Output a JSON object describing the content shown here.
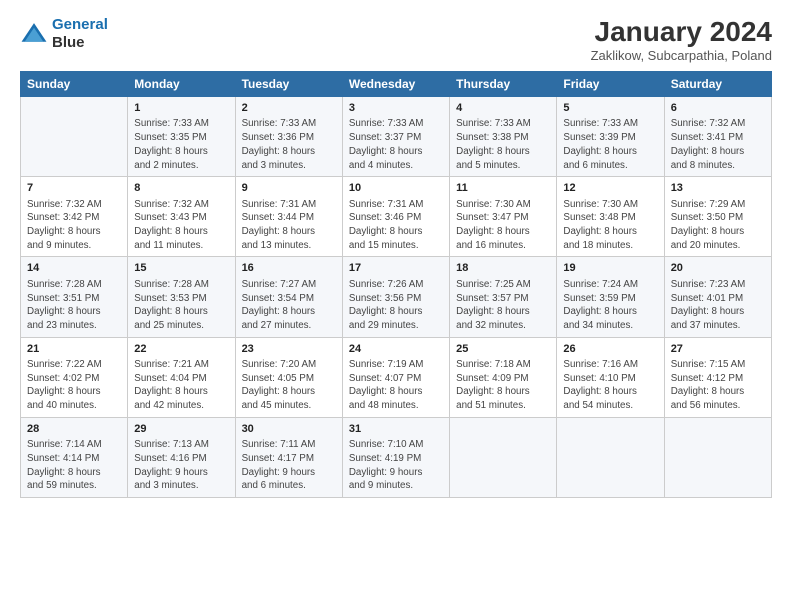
{
  "header": {
    "logo_line1": "General",
    "logo_line2": "Blue",
    "title": "January 2024",
    "subtitle": "Zaklikow, Subcarpathia, Poland"
  },
  "columns": [
    "Sunday",
    "Monday",
    "Tuesday",
    "Wednesday",
    "Thursday",
    "Friday",
    "Saturday"
  ],
  "weeks": [
    [
      {
        "num": "",
        "info": ""
      },
      {
        "num": "1",
        "info": "Sunrise: 7:33 AM\nSunset: 3:35 PM\nDaylight: 8 hours\nand 2 minutes."
      },
      {
        "num": "2",
        "info": "Sunrise: 7:33 AM\nSunset: 3:36 PM\nDaylight: 8 hours\nand 3 minutes."
      },
      {
        "num": "3",
        "info": "Sunrise: 7:33 AM\nSunset: 3:37 PM\nDaylight: 8 hours\nand 4 minutes."
      },
      {
        "num": "4",
        "info": "Sunrise: 7:33 AM\nSunset: 3:38 PM\nDaylight: 8 hours\nand 5 minutes."
      },
      {
        "num": "5",
        "info": "Sunrise: 7:33 AM\nSunset: 3:39 PM\nDaylight: 8 hours\nand 6 minutes."
      },
      {
        "num": "6",
        "info": "Sunrise: 7:32 AM\nSunset: 3:41 PM\nDaylight: 8 hours\nand 8 minutes."
      }
    ],
    [
      {
        "num": "7",
        "info": "Sunrise: 7:32 AM\nSunset: 3:42 PM\nDaylight: 8 hours\nand 9 minutes."
      },
      {
        "num": "8",
        "info": "Sunrise: 7:32 AM\nSunset: 3:43 PM\nDaylight: 8 hours\nand 11 minutes."
      },
      {
        "num": "9",
        "info": "Sunrise: 7:31 AM\nSunset: 3:44 PM\nDaylight: 8 hours\nand 13 minutes."
      },
      {
        "num": "10",
        "info": "Sunrise: 7:31 AM\nSunset: 3:46 PM\nDaylight: 8 hours\nand 15 minutes."
      },
      {
        "num": "11",
        "info": "Sunrise: 7:30 AM\nSunset: 3:47 PM\nDaylight: 8 hours\nand 16 minutes."
      },
      {
        "num": "12",
        "info": "Sunrise: 7:30 AM\nSunset: 3:48 PM\nDaylight: 8 hours\nand 18 minutes."
      },
      {
        "num": "13",
        "info": "Sunrise: 7:29 AM\nSunset: 3:50 PM\nDaylight: 8 hours\nand 20 minutes."
      }
    ],
    [
      {
        "num": "14",
        "info": "Sunrise: 7:28 AM\nSunset: 3:51 PM\nDaylight: 8 hours\nand 23 minutes."
      },
      {
        "num": "15",
        "info": "Sunrise: 7:28 AM\nSunset: 3:53 PM\nDaylight: 8 hours\nand 25 minutes."
      },
      {
        "num": "16",
        "info": "Sunrise: 7:27 AM\nSunset: 3:54 PM\nDaylight: 8 hours\nand 27 minutes."
      },
      {
        "num": "17",
        "info": "Sunrise: 7:26 AM\nSunset: 3:56 PM\nDaylight: 8 hours\nand 29 minutes."
      },
      {
        "num": "18",
        "info": "Sunrise: 7:25 AM\nSunset: 3:57 PM\nDaylight: 8 hours\nand 32 minutes."
      },
      {
        "num": "19",
        "info": "Sunrise: 7:24 AM\nSunset: 3:59 PM\nDaylight: 8 hours\nand 34 minutes."
      },
      {
        "num": "20",
        "info": "Sunrise: 7:23 AM\nSunset: 4:01 PM\nDaylight: 8 hours\nand 37 minutes."
      }
    ],
    [
      {
        "num": "21",
        "info": "Sunrise: 7:22 AM\nSunset: 4:02 PM\nDaylight: 8 hours\nand 40 minutes."
      },
      {
        "num": "22",
        "info": "Sunrise: 7:21 AM\nSunset: 4:04 PM\nDaylight: 8 hours\nand 42 minutes."
      },
      {
        "num": "23",
        "info": "Sunrise: 7:20 AM\nSunset: 4:05 PM\nDaylight: 8 hours\nand 45 minutes."
      },
      {
        "num": "24",
        "info": "Sunrise: 7:19 AM\nSunset: 4:07 PM\nDaylight: 8 hours\nand 48 minutes."
      },
      {
        "num": "25",
        "info": "Sunrise: 7:18 AM\nSunset: 4:09 PM\nDaylight: 8 hours\nand 51 minutes."
      },
      {
        "num": "26",
        "info": "Sunrise: 7:16 AM\nSunset: 4:10 PM\nDaylight: 8 hours\nand 54 minutes."
      },
      {
        "num": "27",
        "info": "Sunrise: 7:15 AM\nSunset: 4:12 PM\nDaylight: 8 hours\nand 56 minutes."
      }
    ],
    [
      {
        "num": "28",
        "info": "Sunrise: 7:14 AM\nSunset: 4:14 PM\nDaylight: 8 hours\nand 59 minutes."
      },
      {
        "num": "29",
        "info": "Sunrise: 7:13 AM\nSunset: 4:16 PM\nDaylight: 9 hours\nand 3 minutes."
      },
      {
        "num": "30",
        "info": "Sunrise: 7:11 AM\nSunset: 4:17 PM\nDaylight: 9 hours\nand 6 minutes."
      },
      {
        "num": "31",
        "info": "Sunrise: 7:10 AM\nSunset: 4:19 PM\nDaylight: 9 hours\nand 9 minutes."
      },
      {
        "num": "",
        "info": ""
      },
      {
        "num": "",
        "info": ""
      },
      {
        "num": "",
        "info": ""
      }
    ]
  ]
}
